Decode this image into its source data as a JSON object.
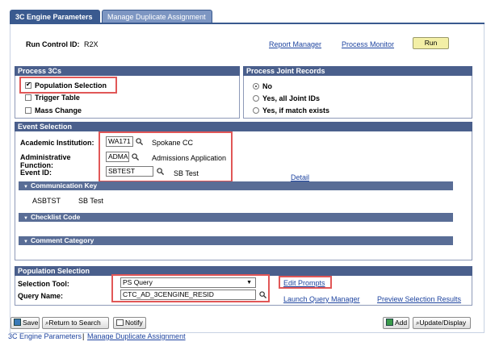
{
  "tabs": [
    {
      "label": "3C Engine Parameters"
    },
    {
      "label": "Manage Duplicate Assignment"
    }
  ],
  "header": {
    "run_control_label": "Run Control ID:",
    "run_control_value": "R2X",
    "report_manager": "Report Manager",
    "process_monitor": "Process Monitor",
    "run_button": "Run"
  },
  "process3cs": {
    "title": "Process 3Cs",
    "options": [
      {
        "label": "Population Selection",
        "checked": true
      },
      {
        "label": "Trigger Table",
        "checked": false
      },
      {
        "label": "Mass Change",
        "checked": false
      }
    ]
  },
  "joint_records": {
    "title": "Process Joint Records",
    "options": [
      {
        "label": "No",
        "selected": true
      },
      {
        "label": "Yes, all Joint IDs",
        "selected": false
      },
      {
        "label": "Yes, if match exists",
        "selected": false
      }
    ]
  },
  "event_selection": {
    "title": "Event Selection",
    "institution_label": "Academic Institution:",
    "institution_value": "WA171",
    "institution_desc": "Spokane CC",
    "admin_function_label": "Administrative Function:",
    "admin_function_value": "ADMA",
    "admin_function_desc": "Admissions Application",
    "event_id_label": "Event ID:",
    "event_id_value": "SBTEST",
    "event_id_desc": "SB Test",
    "detail_link": "Detail",
    "comm_key_title": "Communication Key",
    "comm_key_value": "ASBTST",
    "comm_key_desc": "SB Test",
    "checklist_title": "Checklist Code",
    "comment_title": "Comment Category"
  },
  "population": {
    "title": "Population Selection",
    "tool_label": "Selection Tool:",
    "tool_value": "PS Query",
    "query_label": "Query Name:",
    "query_value": "CTC_AD_3CENGINE_RESID",
    "edit_prompts": "Edit Prompts",
    "launch_query": "Launch Query Manager",
    "preview_results": "Preview Selection Results"
  },
  "footer": {
    "save": "Save",
    "return_search": "Return to Search",
    "notify": "Notify",
    "add": "Add",
    "update_display": "Update/Display",
    "link1": "3C Engine Parameters",
    "separator": "|",
    "link2": "Manage Duplicate Assignment"
  },
  "colors": {
    "section_header": "#4a5f8c",
    "highlight": "#e15757",
    "link": "#1f45a0",
    "run_button": "#f3efa6"
  }
}
